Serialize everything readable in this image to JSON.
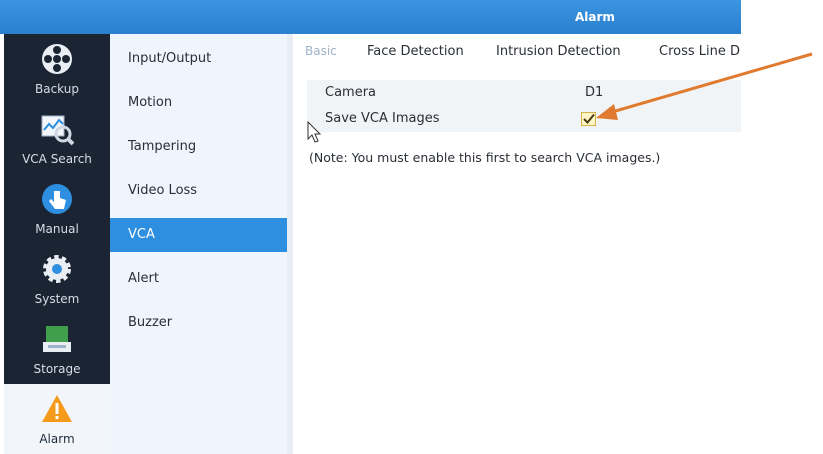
{
  "window": {
    "title": "Alarm"
  },
  "left_nav": {
    "items": [
      {
        "label": "Backup",
        "icon": "film-reel-icon"
      },
      {
        "label": "VCA Search",
        "icon": "chart-magnifier-icon"
      },
      {
        "label": "Manual",
        "icon": "hand-pointer-icon"
      },
      {
        "label": "System",
        "icon": "gear-icon"
      },
      {
        "label": "Storage",
        "icon": "drive-box-icon"
      },
      {
        "label": "Alarm",
        "icon": "warning-icon",
        "active": true
      }
    ]
  },
  "sub_nav": {
    "items": [
      {
        "label": "Input/Output"
      },
      {
        "label": "Motion"
      },
      {
        "label": "Tampering"
      },
      {
        "label": "Video Loss"
      },
      {
        "label": "VCA",
        "active": true
      },
      {
        "label": "Alert"
      },
      {
        "label": "Buzzer"
      }
    ]
  },
  "tabs": [
    {
      "label": "Basic",
      "active": true
    },
    {
      "label": "Face Detection"
    },
    {
      "label": "Intrusion Detection"
    },
    {
      "label": "Cross Line D"
    }
  ],
  "form": {
    "camera_label": "Camera",
    "camera_value": "D1",
    "save_vca_label": "Save VCA Images",
    "save_vca_checked": true,
    "note": "(Note: You must enable this first to search VCA images.)"
  },
  "colors": {
    "titlebar": "#2f8ad8",
    "left_nav_bg": "#1b2433",
    "sub_nav_bg": "#eef5fc",
    "active_blue": "#2e8fe0",
    "annotation_arrow": "#e07a2e"
  }
}
